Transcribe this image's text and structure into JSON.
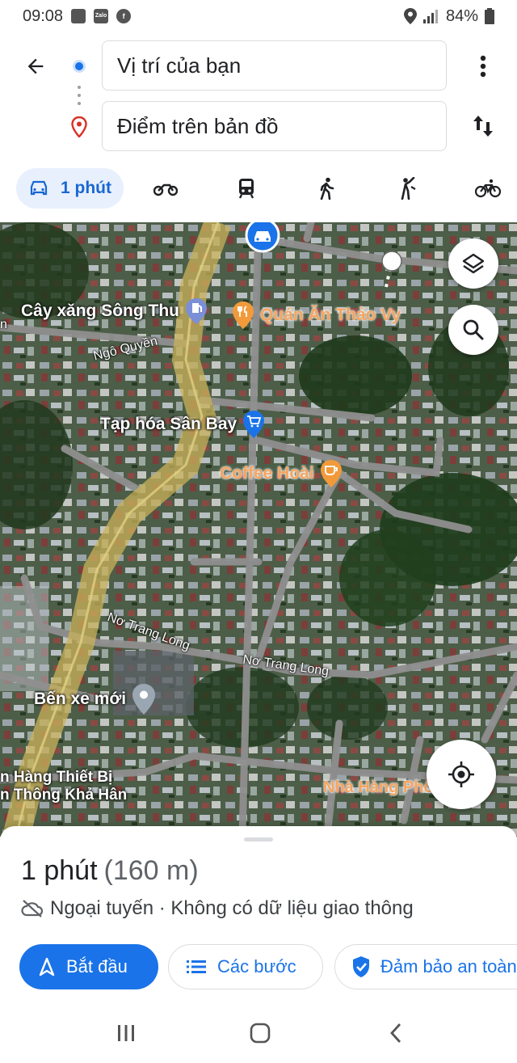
{
  "status_bar": {
    "time": "09:08",
    "notification_icons": [
      "image-icon",
      "zalo-icon",
      "facebook-icon"
    ],
    "zalo_label": "Zalo",
    "battery": "84%"
  },
  "directions": {
    "origin": "Vị trí của bạn",
    "destination": "Điểm trên bản đồ",
    "active_mode_label": "1 phút",
    "modes": [
      "car-icon",
      "motorbike-icon",
      "transit-icon",
      "walk-icon",
      "ride-icon",
      "bike-icon"
    ]
  },
  "map": {
    "pois": {
      "gas_station": "Cây xăng Sông Thu",
      "restaurant_1": "Quán Ăn Thảo Vy",
      "grocery": "Tạp hóa Sân Bay",
      "coffee": "Coffee Hoài",
      "bus_station": "Bến xe mới",
      "electronics_line1": "n Hàng Thiết Bị",
      "electronics_line2": "n Thông Khả Hân",
      "restaurant_2": "Nhà Hàng Phố Núi"
    },
    "roads": {
      "ngo_quyen": "Ngô Quyền",
      "no_trang_long_1": "Nơ Trang Long",
      "no_trang_long_2": "Nơ Trang Long",
      "left_edge": "n"
    },
    "colors": {
      "route_highlight": "#c9b25a",
      "blue_pin": "#1a73e8",
      "orange_pin": "#f29a3a"
    }
  },
  "summary": {
    "duration": "1 phút",
    "distance": "(160 m)",
    "traffic_status": "Ngoại tuyến · Không có dữ liệu giao thông"
  },
  "actions": {
    "start": "Bắt đầu",
    "steps": "Các bước",
    "safety": "Đảm bảo an toàn"
  }
}
